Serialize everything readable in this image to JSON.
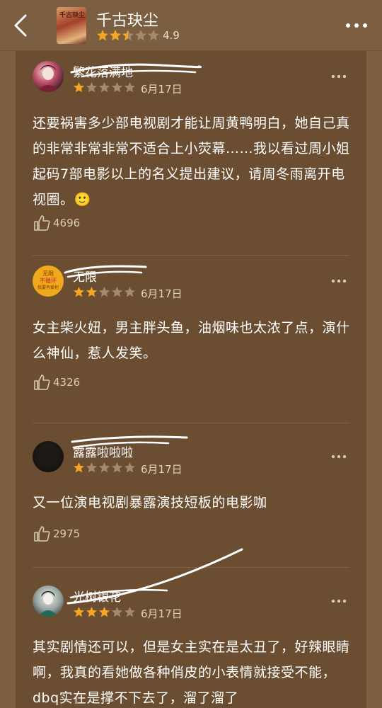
{
  "header": {
    "title": "千古玦尘",
    "score": "4.9",
    "poster_text": "千古玦尘"
  },
  "reviews": [
    {
      "username": "繁花落满地",
      "stars": 1,
      "date": "6月17日",
      "text": "还要祸害多少部电视剧才能让周黄鸭明白，她自己真的非常非常非常不适合上小荧幕……我以看过周小姐起码7部电影以上的名义提出建议，请周冬雨离开电视圈。🙂",
      "likes": "4696"
    },
    {
      "username": "无限",
      "avatar_lines": [
        "无限",
        "不循环",
        "我要有爱祀"
      ],
      "stars": 2,
      "date": "6月17日",
      "text": "女主柴火妞，男主胖头鱼，油烟味也太浓了点，演什么神仙，惹人发笑。",
      "likes": "4326"
    },
    {
      "username": "露露啦啦啦",
      "stars": 1,
      "date": "6月17日",
      "text": "又一位演电视剧暴露演技短板的电影咖",
      "likes": "2975"
    },
    {
      "username": "光树银花",
      "stars": 3,
      "date": "6月17日",
      "text": "其实剧情还可以，但是女主实在是太丑了，好辣眼睛啊，我真的看她做各种俏皮的小表情就接受不能，dbq实在是撑不下去了，溜了溜了",
      "likes": ""
    }
  ],
  "colors": {
    "background": "#7c5e40",
    "card": "#6b4e32",
    "star_filled": "#f5a623",
    "star_empty": "#a58a6e"
  }
}
